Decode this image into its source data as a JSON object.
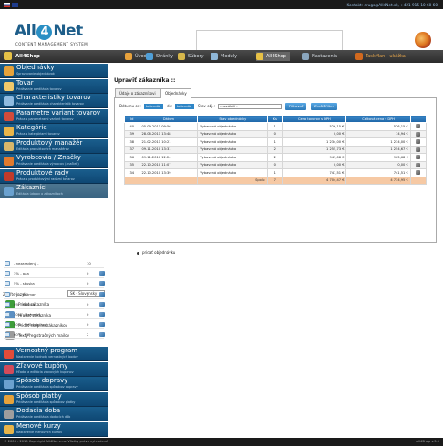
{
  "topbar": {
    "contact": "Kontakt: drugs@All4Net.sk, +421 915 10 60 60",
    "flags": [
      "flag-sk-icon",
      "flag-uk-icon"
    ]
  },
  "logo": {
    "pre": "All",
    "four": "4",
    "post": "Net",
    "sub": "CONTENT MANAGEMENT SYSTEM"
  },
  "navbar": {
    "title": "All4Shop",
    "items": [
      {
        "label": "Úvod",
        "icon": "home-icon",
        "color": "#e8a23c"
      },
      {
        "label": "Stránky",
        "icon": "pages-icon",
        "color": "#4f9fd8"
      },
      {
        "label": "Súbory",
        "icon": "files-icon",
        "color": "#d7b74b"
      },
      {
        "label": "Moduly",
        "icon": "modules-icon",
        "color": "#8fb7d8"
      },
      {
        "label": "All4Shop",
        "icon": "shop-icon",
        "color": "#e7c146"
      },
      {
        "label": "Nastavenia",
        "icon": "settings-icon",
        "color": "#8aa6be"
      },
      {
        "label": "TaskMan - ukážka",
        "icon": "taskman-icon",
        "color": "#d2691e"
      }
    ]
  },
  "sidebar": {
    "menu": [
      {
        "title": "Objednávky",
        "sub": "Spravovanie objednávok",
        "icon": "orders-icon",
        "color": "#e5a23b"
      },
      {
        "title": "Tovar",
        "sub": "Pridávanie a editácia tovarov",
        "icon": "goods-icon",
        "color": "#f0c96a"
      },
      {
        "title": "Charakteristiky tovarov",
        "sub": "Pridávanie a editácia charakteristík tovarov",
        "icon": "characteristics-icon",
        "color": "#8fbbe0"
      },
      {
        "title": "Parametre variant tovarov",
        "sub": "Práca s parametrami variant tovarov",
        "icon": "parameters-icon",
        "color": "#d24b3b"
      },
      {
        "title": "Kategórie",
        "sub": "Práca s kategóriami tovarov",
        "icon": "categories-icon",
        "color": "#e8b54a"
      },
      {
        "title": "Produktový manažér",
        "sub": "Editácia produktových manažérov",
        "icon": "product-manager-icon",
        "color": "#d7b76a"
      },
      {
        "title": "Vyrobcovia / Značky",
        "sub": "Pridávanie a editácia výrobcov (značiek)",
        "icon": "manufacturers-icon",
        "color": "#e07a2e"
      },
      {
        "title": "Produktové rady",
        "sub": "Práca s produktovými radami tovarov",
        "icon": "product-lines-icon",
        "color": "#c03a2b"
      },
      {
        "title": "Zákazníci",
        "sub": "Editácia údajov o zákazníkoch",
        "icon": "customers-icon",
        "color": "#6aa1cf"
      }
    ],
    "language_label": "Zvoľte jazyk:",
    "language_value": "SK - Slovensky",
    "actions": [
      {
        "label": "Pridať zákazníka",
        "icon": "add-customer-icon",
        "color": "#3e9d3a"
      },
      {
        "label": "Hľadať zákazníka",
        "icon": "search-customer-icon",
        "color": "#5b8fc2"
      },
      {
        "label": "Pridať skupinu zákazníkov",
        "icon": "add-group-icon",
        "color": "#3e9d3a"
      },
      {
        "label": "Texty registračných mailov",
        "icon": "mail-texts-icon",
        "color": "#9b9b9b"
      }
    ],
    "groups": [
      {
        "name": "- nezaradený -",
        "count": "10",
        "has_edit": false
      },
      {
        "name": "3% - aaa",
        "count": "0",
        "has_edit": true
      },
      {
        "name": "5% - skuska",
        "count": "0",
        "has_edit": true
      },
      {
        "name": "7% - Batman",
        "count": "2",
        "has_edit": true
      },
      {
        "name": "8% - Rodina",
        "count": "0",
        "has_edit": true
      },
      {
        "name": "10% - Nameraš",
        "count": "0",
        "has_edit": true
      },
      {
        "name": "50% - Veľkoobchod",
        "count": "0",
        "has_edit": true
      },
      {
        "name": "60% - VIP",
        "count": "2",
        "has_edit": true
      }
    ],
    "menu2": [
      {
        "title": "Vernostný program",
        "sub": "Nastavenie hodnoty vernostných bodov",
        "icon": "loyalty-icon",
        "color": "#e24c3a"
      },
      {
        "title": "Zľavové kupóny",
        "sub": "Hľadaj a editácia zľavových kupónov",
        "icon": "coupons-icon",
        "color": "#d24b5a"
      },
      {
        "title": "Spôsob dopravy",
        "sub": "Pridávanie a editácia spôsobov dopravy",
        "icon": "shipping-icon",
        "color": "#6aa1cf"
      },
      {
        "title": "Spôsob platby",
        "sub": "Pridávanie a editácia spôsobov platby",
        "icon": "payment-icon",
        "color": "#e5a23b"
      },
      {
        "title": "Dodacia doba",
        "sub": "Pridávanie a editácia dodacích dôb",
        "icon": "delivery-time-icon",
        "color": "#9e9e9e"
      },
      {
        "title": "Menové kurzy",
        "sub": "Nastavenie menových kurzov",
        "icon": "currency-icon",
        "color": "#e8b54a"
      }
    ]
  },
  "main": {
    "title": "Upraviť zákazníka ::",
    "tabs": [
      "Údaje o zákazníkovi",
      "Objednávky"
    ],
    "filter": {
      "from_label": "Dátumu od:",
      "from_value": "kalendár",
      "to_label": "do:",
      "to_value": "kalendár",
      "state_label": "Stav obj.:",
      "state_value": "- nezáleží -",
      "filter_button": "Filtrovať",
      "clear_button": "Zrušiť filter"
    },
    "columns": [
      "Id",
      "Dátum",
      "Stav objednávky",
      "Ks",
      "Cena tovarov s DPH",
      "Celková cena s DPH",
      ""
    ],
    "rows": [
      {
        "id": "40",
        "date": "05.09.2011 09:56",
        "state": "Vybavená objednávka",
        "qty": "1",
        "goods": "526,15 €",
        "total": "526,15 €"
      },
      {
        "id": "39",
        "date": "28.06.2011 13:48",
        "state": "Vybavená objednávka",
        "qty": "0",
        "goods": "0,00 €",
        "total": "14,94 €"
      },
      {
        "id": "38",
        "date": "21.02.2011 10:21",
        "state": "Vybavená objednávka",
        "qty": "1",
        "goods": "1 234,00 €",
        "total": "1 234,00 €"
      },
      {
        "id": "37",
        "date": "09.11.2010 13:31",
        "state": "Vybavená objednávka",
        "qty": "2",
        "goods": "1 255,73 €",
        "total": "1 254,67 €"
      },
      {
        "id": "36",
        "date": "09.11.2010 12:24",
        "state": "Vybavená objednávka",
        "qty": "2",
        "goods": "947,08 €",
        "total": "963,68 €"
      },
      {
        "id": "35",
        "date": "22.10.2010 11:07",
        "state": "Vybavená objednávka",
        "qty": "0",
        "goods": "0,00 €",
        "total": "0,00 €"
      },
      {
        "id": "34",
        "date": "22.10.2010 13:39",
        "state": "Vybavená objednávka",
        "qty": "1",
        "goods": "741,51 €",
        "total": "741,51 €"
      }
    ],
    "sum": {
      "label": "Spolu:",
      "qty": "7",
      "goods": "4 704,47 €",
      "total": "4 734,95 €"
    },
    "add_order": "pridať objednávku"
  },
  "footer": {
    "left": "© 2006 - 2015 Copyright All4Net s.r.o. Všetky práva vyhradené.",
    "right": "All4Shop v.3.5"
  }
}
